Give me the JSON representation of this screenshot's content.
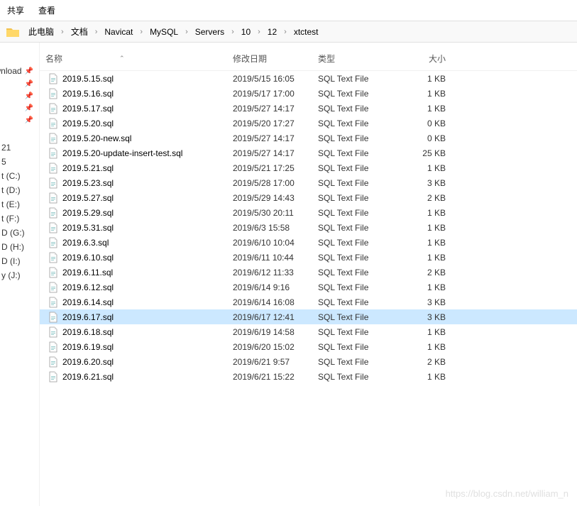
{
  "menubar": {
    "share": "共享",
    "view": "查看"
  },
  "breadcrumb": {
    "items": [
      "此电脑",
      "文档",
      "Navicat",
      "MySQL",
      "Servers",
      "10",
      "12",
      "xtctest"
    ]
  },
  "sidebar": {
    "quick": [
      {
        "label": "wnload",
        "pinned": true
      },
      {
        "label": "",
        "pinned": true
      },
      {
        "label": "",
        "pinned": true
      },
      {
        "label": "",
        "pinned": true
      },
      {
        "label": "",
        "pinned": true
      }
    ],
    "drives": [
      {
        "label": "21"
      },
      {
        "label": "5"
      },
      {
        "label": "t (C:)"
      },
      {
        "label": "t (D:)"
      },
      {
        "label": "t (E:)"
      },
      {
        "label": "t (F:)"
      },
      {
        "label": "D (G:)"
      },
      {
        "label": "D (H:)"
      },
      {
        "label": "D (I:)"
      },
      {
        "label": "y (J:)"
      }
    ]
  },
  "columns": {
    "name": "名称",
    "date": "修改日期",
    "type": "类型",
    "size": "大小"
  },
  "files": [
    {
      "name": "2019.5.15.sql",
      "date": "2019/5/15 16:05",
      "type": "SQL Text File",
      "size": "1 KB",
      "selected": false
    },
    {
      "name": "2019.5.16.sql",
      "date": "2019/5/17 17:00",
      "type": "SQL Text File",
      "size": "1 KB",
      "selected": false
    },
    {
      "name": "2019.5.17.sql",
      "date": "2019/5/27 14:17",
      "type": "SQL Text File",
      "size": "1 KB",
      "selected": false
    },
    {
      "name": "2019.5.20.sql",
      "date": "2019/5/20 17:27",
      "type": "SQL Text File",
      "size": "0 KB",
      "selected": false
    },
    {
      "name": "2019.5.20-new.sql",
      "date": "2019/5/27 14:17",
      "type": "SQL Text File",
      "size": "0 KB",
      "selected": false
    },
    {
      "name": "2019.5.20-update-insert-test.sql",
      "date": "2019/5/27 14:17",
      "type": "SQL Text File",
      "size": "25 KB",
      "selected": false
    },
    {
      "name": "2019.5.21.sql",
      "date": "2019/5/21 17:25",
      "type": "SQL Text File",
      "size": "1 KB",
      "selected": false
    },
    {
      "name": "2019.5.23.sql",
      "date": "2019/5/28 17:00",
      "type": "SQL Text File",
      "size": "3 KB",
      "selected": false
    },
    {
      "name": "2019.5.27.sql",
      "date": "2019/5/29 14:43",
      "type": "SQL Text File",
      "size": "2 KB",
      "selected": false
    },
    {
      "name": "2019.5.29.sql",
      "date": "2019/5/30 20:11",
      "type": "SQL Text File",
      "size": "1 KB",
      "selected": false
    },
    {
      "name": "2019.5.31.sql",
      "date": "2019/6/3 15:58",
      "type": "SQL Text File",
      "size": "1 KB",
      "selected": false
    },
    {
      "name": "2019.6.3.sql",
      "date": "2019/6/10 10:04",
      "type": "SQL Text File",
      "size": "1 KB",
      "selected": false
    },
    {
      "name": "2019.6.10.sql",
      "date": "2019/6/11 10:44",
      "type": "SQL Text File",
      "size": "1 KB",
      "selected": false
    },
    {
      "name": "2019.6.11.sql",
      "date": "2019/6/12 11:33",
      "type": "SQL Text File",
      "size": "2 KB",
      "selected": false
    },
    {
      "name": "2019.6.12.sql",
      "date": "2019/6/14 9:16",
      "type": "SQL Text File",
      "size": "1 KB",
      "selected": false
    },
    {
      "name": "2019.6.14.sql",
      "date": "2019/6/14 16:08",
      "type": "SQL Text File",
      "size": "3 KB",
      "selected": false
    },
    {
      "name": "2019.6.17.sql",
      "date": "2019/6/17 12:41",
      "type": "SQL Text File",
      "size": "3 KB",
      "selected": true
    },
    {
      "name": "2019.6.18.sql",
      "date": "2019/6/19 14:58",
      "type": "SQL Text File",
      "size": "1 KB",
      "selected": false
    },
    {
      "name": "2019.6.19.sql",
      "date": "2019/6/20 15:02",
      "type": "SQL Text File",
      "size": "1 KB",
      "selected": false
    },
    {
      "name": "2019.6.20.sql",
      "date": "2019/6/21 9:57",
      "type": "SQL Text File",
      "size": "2 KB",
      "selected": false
    },
    {
      "name": "2019.6.21.sql",
      "date": "2019/6/21 15:22",
      "type": "SQL Text File",
      "size": "1 KB",
      "selected": false
    }
  ],
  "watermark": "https://blog.csdn.net/william_n"
}
